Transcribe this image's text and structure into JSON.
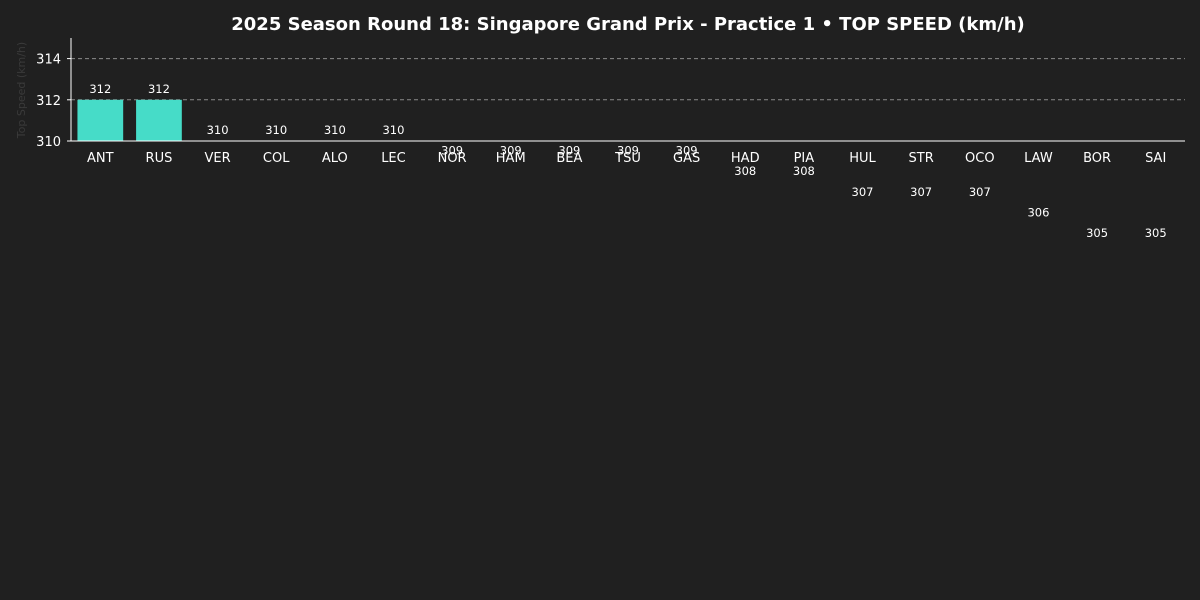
{
  "chart_data": {
    "type": "bar",
    "title": "2025 Season Round 18: Singapore Grand Prix - Practice 1  •  TOP SPEED (km/h)",
    "ylabel": "Top Speed (km/h)",
    "xlabel": "",
    "categories": [
      "ANT",
      "RUS",
      "VER",
      "COL",
      "ALO",
      "LEC",
      "NOR",
      "HAM",
      "BEA",
      "TSU",
      "GAS",
      "HAD",
      "PIA",
      "HUL",
      "STR",
      "OCO",
      "LAW",
      "BOR",
      "SAI"
    ],
    "values": [
      312,
      312,
      310,
      310,
      310,
      310,
      309,
      309,
      309,
      309,
      309,
      308,
      308,
      307,
      307,
      307,
      306,
      305,
      305
    ],
    "ylim": [
      310,
      315
    ],
    "yticks": [
      310,
      312,
      314
    ],
    "grid": true,
    "colors": {
      "bar": "#46dcc8",
      "background": "#202020",
      "axis": "#ffffff",
      "grid": "#8a8a8a"
    }
  }
}
